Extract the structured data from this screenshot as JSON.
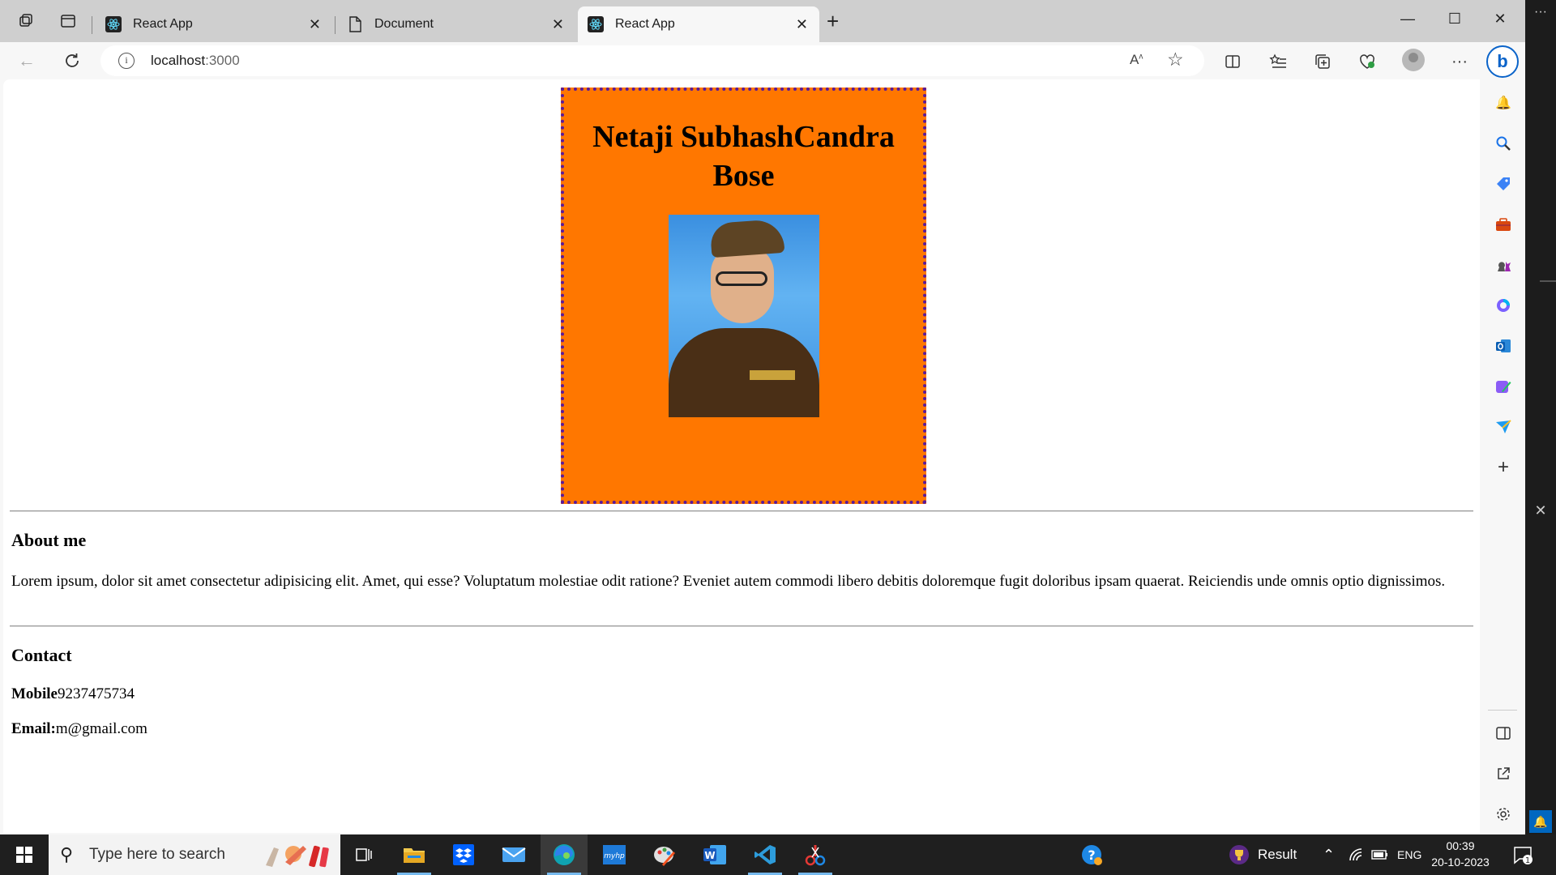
{
  "browser": {
    "tabs": [
      {
        "label": "React App",
        "icon": "react-icon",
        "active": false
      },
      {
        "label": "Document",
        "icon": "document-icon",
        "active": false
      },
      {
        "label": "React App",
        "icon": "react-icon",
        "active": true
      }
    ],
    "url_host": "localhost",
    "url_port": ":3000",
    "read_aloud_glyph": "Aᵃ",
    "sidebar_icons": [
      "bing-icon",
      "bell-icon",
      "search-icon",
      "shopping-tag-icon",
      "toolbox-icon",
      "chess-icon",
      "office-icon",
      "outlook-icon",
      "designer-icon",
      "send-icon",
      "add-icon",
      "split-screen-icon",
      "external-link-icon",
      "settings-icon"
    ]
  },
  "page": {
    "hero_title": "Netaji SubhashCandra Bose",
    "portrait_alt": "",
    "about_heading": "About me",
    "about_text": "Lorem ipsum, dolor sit amet consectetur adipisicing elit. Amet, qui esse? Voluptatum molestiae odit ratione? Eveniet autem commodi libero debitis doloremque fugit doloribus ipsam quaerat. Reiciendis unde omnis optio dignissimos.",
    "contact_heading": "Contact",
    "mobile_label": "Mobile",
    "mobile_value": "9237475734",
    "email_label": "Email:",
    "email_value": "m@gmail.com"
  },
  "taskbar": {
    "search_placeholder": "Type here to search",
    "result_label": "Result",
    "lang": "ENG",
    "time": "00:39",
    "date": "20-10-2023",
    "notification_count": "1"
  },
  "colors": {
    "card_bg": "#ff7700",
    "card_border": "#5a1a9a",
    "taskbar_bg": "#1f1f1f",
    "accent": "#0067c0"
  }
}
